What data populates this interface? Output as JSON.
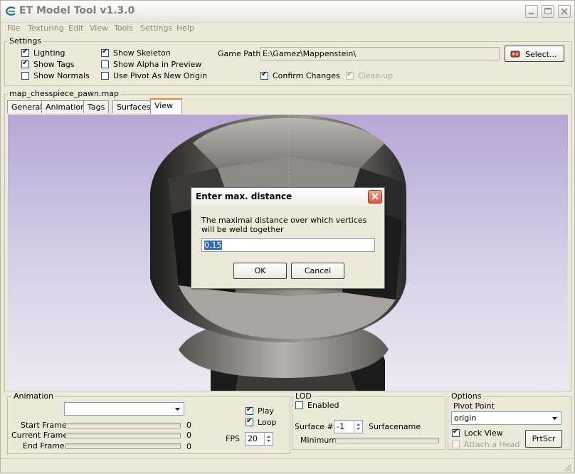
{
  "window": {
    "title": "ET Model Tool v1.3.0"
  },
  "menu": [
    "File",
    "Texturing",
    "Edit",
    "View",
    "Tools",
    "Settings",
    "Help"
  ],
  "settings": {
    "group_label": "Settings",
    "lighting": "Lighting",
    "show_tags": "Show Tags",
    "show_normals": "Show Normals",
    "show_skeleton": "Show Skeleton",
    "show_alpha": "Show Alpha in Preview",
    "use_pivot": "Use Pivot As New Origin",
    "game_path_label": "Game Path",
    "game_path_value": "E:\\Gamez\\Mappenstein\\",
    "select_button": "Select...",
    "confirm_changes": "Confirm Changes",
    "cleanup": "Clean-up"
  },
  "model": {
    "filename": "map_chesspiece_pawn.map",
    "tabs": [
      "General",
      "Animation",
      "Tags",
      "Surfaces",
      "View"
    ]
  },
  "dialog": {
    "title": "Enter max. distance",
    "message": "The maximal distance over which vertices will be weld together",
    "value": "0.15",
    "ok": "OK",
    "cancel": "Cancel"
  },
  "animation": {
    "group_label": "Animation",
    "start_frame": "Start Frame",
    "current_frame": "Current Frame",
    "end_frame": "End Frame",
    "start_value": "0",
    "current_value": "0",
    "end_value": "0",
    "play": "Play",
    "loop": "Loop",
    "fps_label": "FPS",
    "fps_value": "20"
  },
  "lod": {
    "group_label": "LOD",
    "enabled": "Enabled",
    "surface_label": "Surface #",
    "surface_value": "-1",
    "surfacename": "Surfacename",
    "minimum": "Minimum"
  },
  "options": {
    "group_label": "Options",
    "pivot_label": "Pivot Point",
    "pivot_value": "origin",
    "lock_view": "Lock View",
    "attach_head": "Attach a Head",
    "prtscr": "PrtScr"
  },
  "colors": {
    "accent_tab": "#e68b2c",
    "viewport_bg": "#b8a6d6",
    "dialog_close": "#d9563a"
  }
}
